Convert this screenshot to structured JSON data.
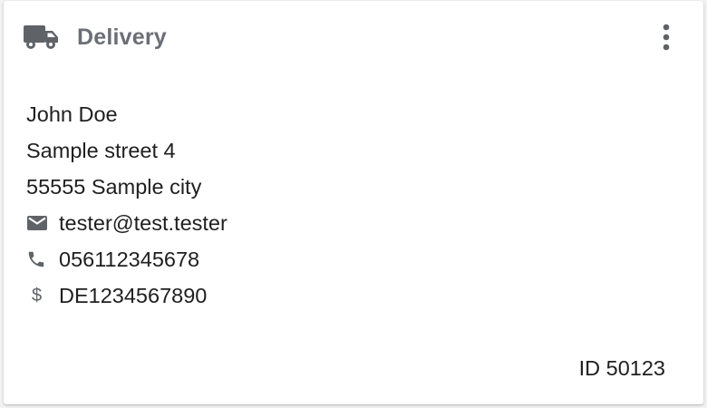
{
  "card": {
    "icon": "truck-icon",
    "title": "Delivery",
    "menu_icon": "more-vert-icon"
  },
  "address": {
    "name": "John Doe",
    "street": "Sample street 4",
    "city": "55555 Sample city"
  },
  "contact": {
    "email": "tester@test.tester",
    "email_icon": "mail-icon",
    "phone": "056112345678",
    "phone_icon": "phone-icon",
    "tax_id": "DE1234567890",
    "tax_icon": "dollar-icon",
    "tax_glyph": "$"
  },
  "footer": {
    "id_label": "ID 50123"
  },
  "colors": {
    "icon_gray": "#5f6368",
    "title_gray": "#6b6e76",
    "text": "#1f1f1f"
  }
}
